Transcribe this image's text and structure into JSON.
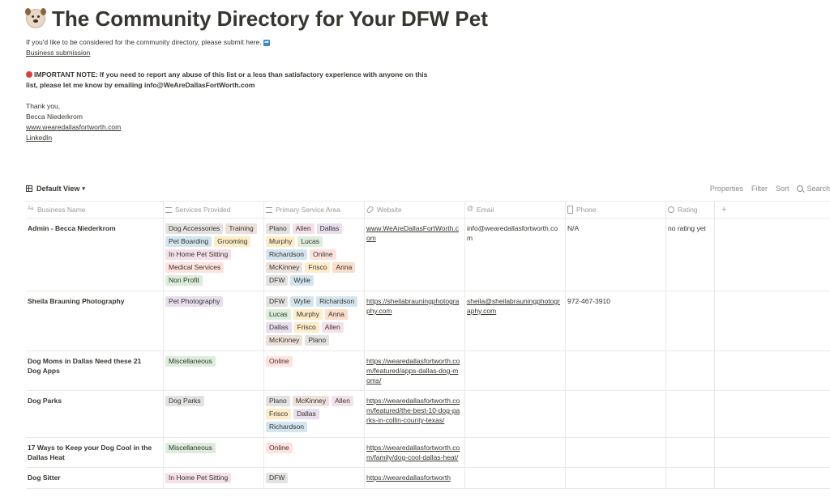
{
  "page": {
    "title": "The Community Directory for Your DFW Pet",
    "intro_line": "If you'd like to be considered for the community directory, please submit here.",
    "business_link": "Business submission",
    "important_note": "IMPORTANT NOTE: If you need to report any abuse of this list or a less than satisfactory experience with anyone on this list, please let me know by emailing info@WeAreDallasFortWorth.com",
    "thanks": "Thank you,",
    "signature": "Becca Niederkrom",
    "site_link": "www.wearedallasfortworth.com",
    "linkedin": "LinkedIn"
  },
  "view": {
    "name": "Default View",
    "tools": [
      "Properties",
      "Filter",
      "Sort",
      "Search"
    ]
  },
  "columns": [
    "Business Name",
    "Services Provided",
    "Primary Service Area",
    "Website",
    "Email",
    "Phone",
    "Rating"
  ],
  "colors": {
    "gray": "#e3e2e0",
    "brown": "#eee0da",
    "orange": "#fadec9",
    "yellow": "#fdecc8",
    "green": "#dbeddb",
    "blue": "#d3e5ef",
    "purple": "#e8deee",
    "pink": "#f5e0e9",
    "red": "#ffe2dd"
  },
  "rows": [
    {
      "name": "Admin - Becca Niederkrom",
      "services": [
        {
          "t": "Dog Accessories",
          "c": "gray"
        },
        {
          "t": "Training",
          "c": "brown"
        },
        {
          "t": "Pet Boarding",
          "c": "blue"
        },
        {
          "t": "Grooming",
          "c": "yellow"
        },
        {
          "t": "In Home Pet Sitting",
          "c": "pink"
        },
        {
          "t": "Medical Services",
          "c": "red"
        },
        {
          "t": "Non Profit",
          "c": "green"
        }
      ],
      "areas": [
        {
          "t": "Plano",
          "c": "gray"
        },
        {
          "t": "Allen",
          "c": "pink"
        },
        {
          "t": "Dallas",
          "c": "purple"
        },
        {
          "t": "Murphy",
          "c": "yellow"
        },
        {
          "t": "Lucas",
          "c": "green"
        },
        {
          "t": "Richardson",
          "c": "blue"
        },
        {
          "t": "Online",
          "c": "red"
        },
        {
          "t": "McKinney",
          "c": "brown"
        },
        {
          "t": "Frisco",
          "c": "yellow"
        },
        {
          "t": "Anna",
          "c": "orange"
        },
        {
          "t": "DFW",
          "c": "gray"
        },
        {
          "t": "Wylie",
          "c": "blue"
        }
      ],
      "website": "www.WeAreDallasFortWorth.com",
      "email": "info@wearedallasfortworth.com",
      "email_link": false,
      "phone": "N/A",
      "rating": "no rating yet"
    },
    {
      "name": "Sheila Brauning Photography",
      "services": [
        {
          "t": "Pet Photography",
          "c": "purple"
        }
      ],
      "areas": [
        {
          "t": "DFW",
          "c": "gray"
        },
        {
          "t": "Wylie",
          "c": "blue"
        },
        {
          "t": "Richardson",
          "c": "blue"
        },
        {
          "t": "Lucas",
          "c": "green"
        },
        {
          "t": "Murphy",
          "c": "yellow"
        },
        {
          "t": "Anna",
          "c": "orange"
        },
        {
          "t": "Dallas",
          "c": "purple"
        },
        {
          "t": "Frisco",
          "c": "yellow"
        },
        {
          "t": "Allen",
          "c": "pink"
        },
        {
          "t": "McKinney",
          "c": "brown"
        },
        {
          "t": "Plano",
          "c": "gray"
        }
      ],
      "website": "https://sheilabrauningphotography.com",
      "email": "sheila@sheilabrauningphotography.com",
      "email_link": true,
      "phone": "972-467-3910",
      "rating": ""
    },
    {
      "name": "Dog Moms in Dallas Need these 21 Dog Apps",
      "services": [
        {
          "t": "Miscellaneous",
          "c": "green"
        }
      ],
      "areas": [
        {
          "t": "Online",
          "c": "red"
        }
      ],
      "website": "https://wearedallasfortworth.com/featured/apps-dallas-dog-moms/",
      "email": "",
      "email_link": false,
      "phone": "",
      "rating": ""
    },
    {
      "name": "Dog Parks",
      "services": [
        {
          "t": "Dog Parks",
          "c": "gray"
        }
      ],
      "areas": [
        {
          "t": "Plano",
          "c": "gray"
        },
        {
          "t": "McKinney",
          "c": "brown"
        },
        {
          "t": "Allen",
          "c": "pink"
        },
        {
          "t": "Frisco",
          "c": "yellow"
        },
        {
          "t": "Dallas",
          "c": "purple"
        },
        {
          "t": "Richardson",
          "c": "blue"
        }
      ],
      "website": "https://wearedallasfortworth.com/featured/the-best-10-dog-parks-in-collin-county-texas/",
      "email": "",
      "email_link": false,
      "phone": "",
      "rating": ""
    },
    {
      "name": "17 Ways to Keep your Dog Cool in the Dallas Heat",
      "services": [
        {
          "t": "Miscellaneous",
          "c": "green"
        }
      ],
      "areas": [
        {
          "t": "Online",
          "c": "red"
        }
      ],
      "website": "https://wearedallasfortworth.com/family/dog-cool-dallas-heat/",
      "email": "",
      "email_link": false,
      "phone": "",
      "rating": ""
    },
    {
      "name": "Dog Sitter",
      "services": [
        {
          "t": "In Home Pet Sitting",
          "c": "pink"
        }
      ],
      "areas": [
        {
          "t": "DFW",
          "c": "gray"
        }
      ],
      "website": "https://wearedallasfortworth",
      "email": "",
      "email_link": false,
      "phone": "",
      "rating": ""
    }
  ]
}
